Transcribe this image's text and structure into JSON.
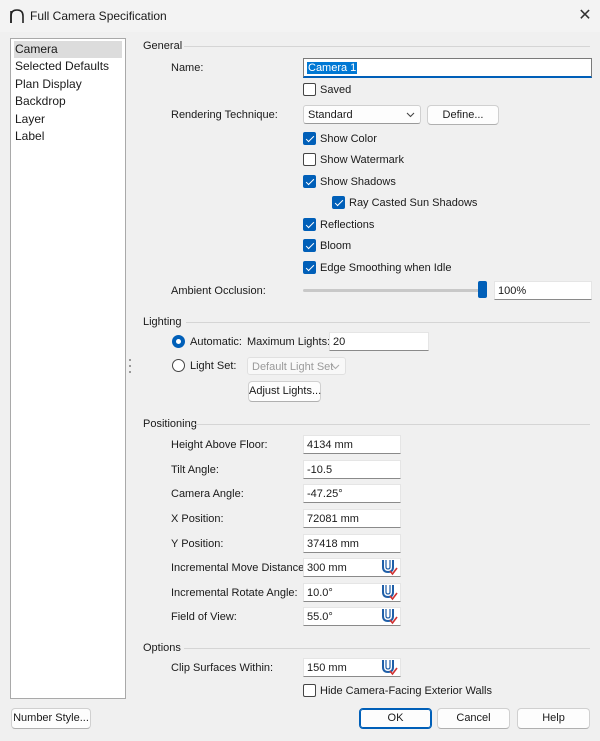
{
  "window": {
    "title": "Full Camera Specification",
    "close_symbol": "✕",
    "app_icon": "arch-icon"
  },
  "sidebar": {
    "items": [
      {
        "label": "Camera",
        "selected": true
      },
      {
        "label": "Selected Defaults",
        "selected": false
      },
      {
        "label": "Plan Display",
        "selected": false
      },
      {
        "label": "Backdrop",
        "selected": false
      },
      {
        "label": "Layer",
        "selected": false
      },
      {
        "label": "Label",
        "selected": false
      }
    ]
  },
  "general": {
    "section_title": "General",
    "name_label": "Name:",
    "name_value": "Camera 1",
    "saved_label": "Saved",
    "saved_checked": false,
    "rendering_label": "Rendering Technique:",
    "rendering_value": "Standard",
    "define_button": "Define...",
    "show_color": {
      "label": "Show Color",
      "checked": true
    },
    "show_watermark": {
      "label": "Show Watermark",
      "checked": false
    },
    "show_shadows": {
      "label": "Show Shadows",
      "checked": true
    },
    "ray_casted": {
      "label": "Ray Casted Sun Shadows",
      "checked": true
    },
    "reflections": {
      "label": "Reflections",
      "checked": true
    },
    "bloom": {
      "label": "Bloom",
      "checked": true
    },
    "edge_smoothing": {
      "label": "Edge Smoothing when Idle",
      "checked": true
    },
    "ambient_label": "Ambient Occlusion:",
    "ambient_value": "100%",
    "ambient_level": 1.0
  },
  "lighting": {
    "section_title": "Lighting",
    "automatic_label": "Automatic:",
    "automatic_selected": true,
    "max_lights_label": "Maximum Lights:",
    "max_lights_value": "20",
    "light_set_label": "Light Set:",
    "light_set_selected": false,
    "light_set_value": "Default Light Set",
    "adjust_button": "Adjust Lights..."
  },
  "positioning": {
    "section_title": "Positioning",
    "fields": [
      {
        "label": "Height Above Floor:",
        "value": "4134 mm",
        "has_icon": false
      },
      {
        "label": "Tilt Angle:",
        "value": "-10.5",
        "has_icon": false
      },
      {
        "label": "Camera Angle:",
        "value": "-47.25°",
        "has_icon": false
      },
      {
        "label": "X Position:",
        "value": "72081 mm",
        "has_icon": false
      },
      {
        "label": "Y Position:",
        "value": "37418 mm",
        "has_icon": false
      },
      {
        "label": "Incremental Move Distance:",
        "value": "300 mm",
        "has_icon": true
      },
      {
        "label": "Incremental Rotate Angle:",
        "value": "10.0°",
        "has_icon": true
      },
      {
        "label": "Field of View:",
        "value": "55.0°",
        "has_icon": true
      }
    ]
  },
  "options": {
    "section_title": "Options",
    "clip_label": "Clip Surfaces Within:",
    "clip_value": "150 mm",
    "hide_walls": {
      "label": "Hide Camera-Facing Exterior Walls",
      "checked": false
    }
  },
  "footer": {
    "number_style": "Number Style...",
    "ok": "OK",
    "cancel": "Cancel",
    "help": "Help"
  },
  "colors": {
    "accent": "#005fb8",
    "dialog_bg": "#f0f0f0",
    "selection_bg": "#0078d4"
  },
  "icons": {
    "field_icon": "magnet-snap-icon",
    "dropdown": "chevron-down-icon"
  }
}
